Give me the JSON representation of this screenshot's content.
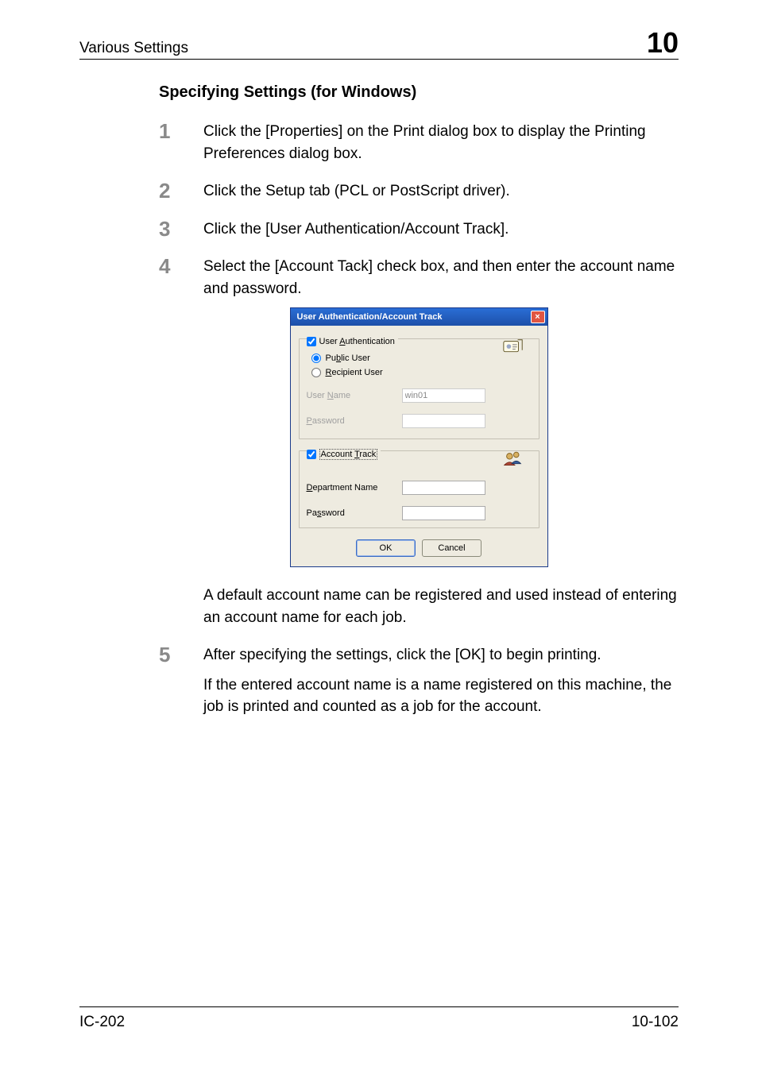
{
  "header": {
    "title": "Various Settings",
    "chapter": "10"
  },
  "section_heading": "Specifying Settings (for Windows)",
  "steps": [
    {
      "num": "1",
      "body1": "Click the [Properties] on the Print dialog box to display the Printing Preferences dialog box."
    },
    {
      "num": "2",
      "body1": "Click the Setup tab (PCL or PostScript driver)."
    },
    {
      "num": "3",
      "body1": "Click the [User Authentication/Account Track]."
    },
    {
      "num": "4",
      "body1": "Select the [Account Tack] check box, and then enter the account name and password.",
      "note": "A default account name can be registered and used instead of entering an account name for each job."
    },
    {
      "num": "5",
      "body1": "After specifying the settings, click the [OK] to begin printing.",
      "body2": "If the entered account name is a name registered on this machine, the job is printed and counted as a job for the account."
    }
  ],
  "dialog": {
    "title": "User Authentication/Account Track",
    "close": "×",
    "userauth": {
      "checkbox_label_pre": "User ",
      "checkbox_label_u": "A",
      "checkbox_label_post": "uthentication",
      "public_pre": "Pu",
      "public_u": "b",
      "public_post": "lic User",
      "recipient_pre": "",
      "recipient_u": "R",
      "recipient_post": "ecipient User",
      "username_label_pre": "User ",
      "username_label_u": "N",
      "username_label_post": "ame",
      "username_value": "win01",
      "password_label_pre": "",
      "password_label_u": "P",
      "password_label_post": "assword"
    },
    "accounttrack": {
      "checkbox_label_pre": "Account ",
      "checkbox_label_u": "T",
      "checkbox_label_post": "rack",
      "dept_label_pre": "",
      "dept_label_u": "D",
      "dept_label_post": "epartment Name",
      "password_label_pre": "Pa",
      "password_label_u": "s",
      "password_label_post": "sword"
    },
    "buttons": {
      "ok": "OK",
      "cancel": "Cancel"
    }
  },
  "footer": {
    "left": "IC-202",
    "right": "10-102"
  }
}
